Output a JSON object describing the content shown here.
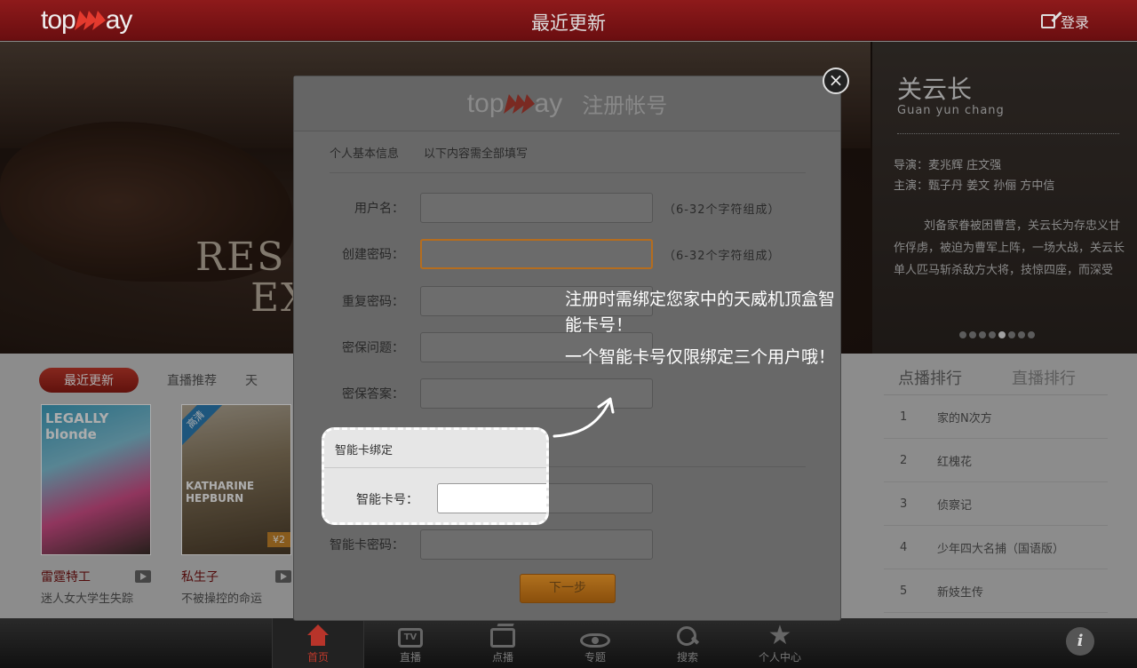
{
  "header": {
    "title": "最近更新",
    "login_label": "登录"
  },
  "hero": {
    "movie_title_line1": "RES",
    "movie_title_line2": "EX",
    "name": "关云长",
    "pinyin": "Guan yun chang",
    "director_label": "导演：",
    "director": "麦兆辉 庄文强",
    "cast_label": "主演：",
    "cast": "甄子丹 姜文 孙俪 方中信",
    "description": "刘备家眷被困曹营，关云长为存忠义甘作俘虏，被迫为曹军上阵，一场大战，关云长单人匹马斩杀敌方大将，技惊四座，而深受"
  },
  "content": {
    "tabs": [
      {
        "label": "最近更新"
      },
      {
        "label": "直播推荐"
      },
      {
        "label": "天"
      }
    ],
    "movies": [
      {
        "title": "雷霆特工",
        "desc": "迷人女大学生失踪",
        "poster_text": "LEGALLY blonde"
      },
      {
        "title": "私生子",
        "desc": "不被操控的命运",
        "poster_text": "KATHARINE HEPBURN",
        "badge": "高清",
        "price": "¥2"
      }
    ]
  },
  "ranking": {
    "tab_vod": "点播排行",
    "tab_live": "直播排行",
    "items": [
      {
        "num": "1",
        "title": "家的N次方"
      },
      {
        "num": "2",
        "title": "红槐花"
      },
      {
        "num": "3",
        "title": "侦察记"
      },
      {
        "num": "4",
        "title": "少年四大名捕（国语版）"
      },
      {
        "num": "5",
        "title": "新妓生传"
      }
    ]
  },
  "bottom_nav": [
    {
      "label": "首页",
      "icon": "home-icon"
    },
    {
      "label": "直播",
      "icon": "tv-icon"
    },
    {
      "label": "点播",
      "icon": "film-icon"
    },
    {
      "label": "专题",
      "icon": "eye-icon"
    },
    {
      "label": "搜索",
      "icon": "search-icon"
    },
    {
      "label": "个人中心",
      "icon": "star-icon"
    }
  ],
  "modal": {
    "logo_left": "top",
    "logo_right": "ay",
    "title": "注册帐号",
    "section_label": "个人基本信息",
    "section_note": "以下内容需全部填写",
    "fields": [
      {
        "label": "用户名：",
        "hint": "（6-32个字符组成）"
      },
      {
        "label": "创建密码：",
        "hint": "（6-32个字符组成）"
      },
      {
        "label": "重复密码：",
        "hint": ""
      },
      {
        "label": "密保问题：",
        "hint": ""
      },
      {
        "label": "密保答案：",
        "hint": ""
      }
    ],
    "card_password_label": "智能卡密码：",
    "next_label": "下一步",
    "close_label": "×"
  },
  "highlight": {
    "title": "智能卡绑定",
    "card_label": "智能卡号："
  },
  "tip": {
    "line1": "注册时需绑定您家中的天威机顶盒智能卡号！",
    "line2": "一个智能卡号仅限绑定三个用户哦！"
  },
  "logo": {
    "left": "top",
    "right": "ay"
  },
  "colors": {
    "brand_red": "#8e1a1b",
    "accent_orange": "#b0711e"
  }
}
